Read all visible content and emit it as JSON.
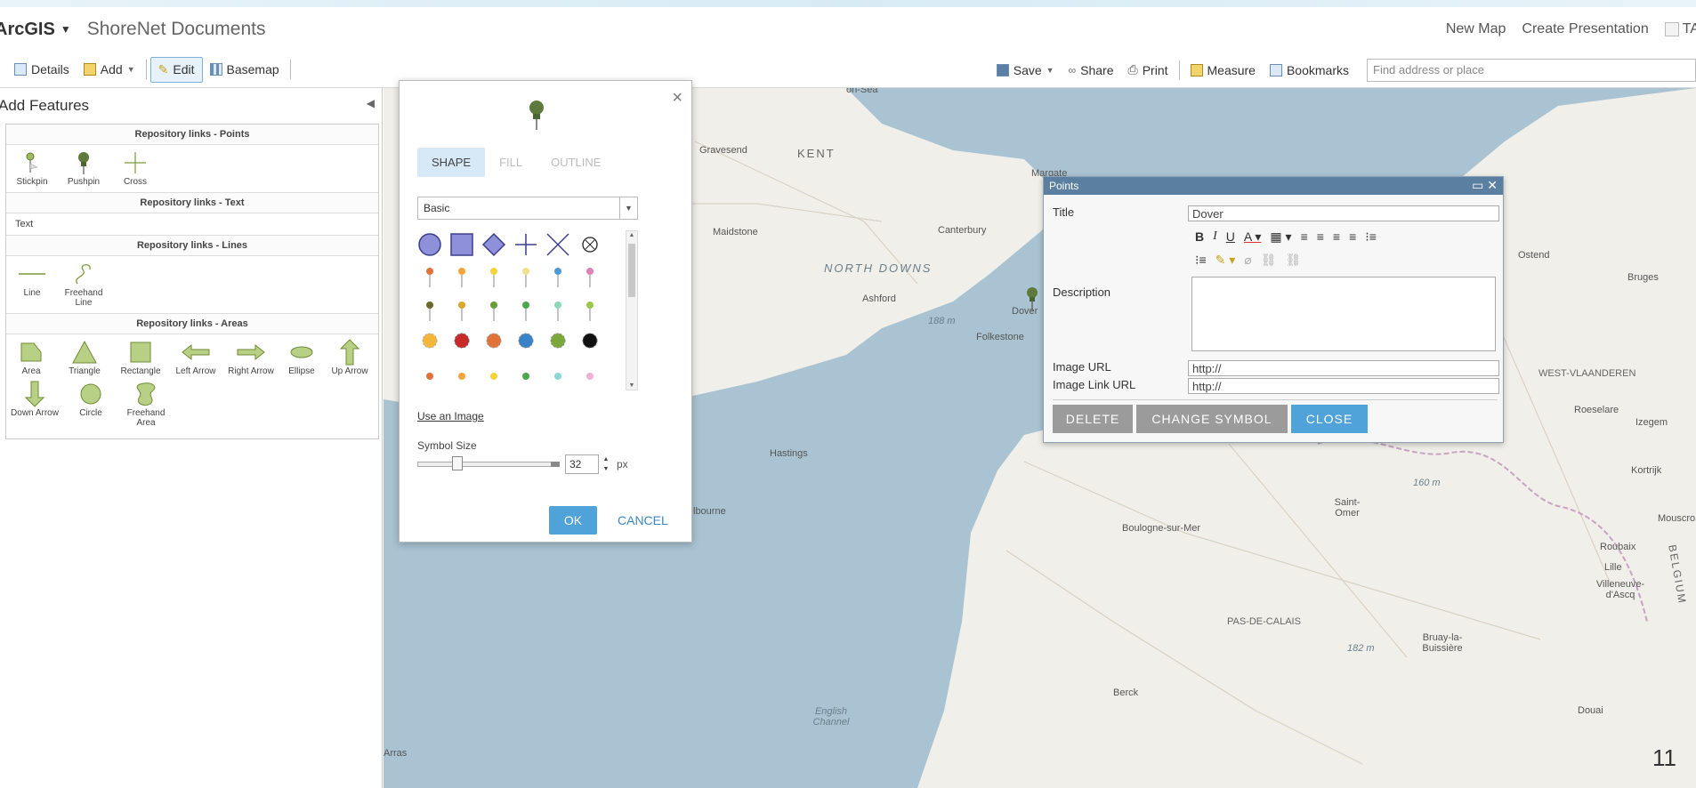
{
  "header": {
    "brand": "ArcGIS",
    "org_title": "ShoreNet Documents",
    "links": [
      "New Map",
      "Create Presentation"
    ],
    "tab_partial": "TA"
  },
  "toolbar": {
    "left": [
      "Details",
      "Add",
      "Edit",
      "Basemap"
    ],
    "right": [
      "Save",
      "Share",
      "Print",
      "Measure",
      "Bookmarks"
    ],
    "search_placeholder": "Find address or place"
  },
  "left_panel": {
    "title": "Add Features",
    "groups": [
      {
        "heading": "Repository links - Points",
        "items": [
          "Stickpin",
          "Pushpin",
          "Cross"
        ]
      },
      {
        "heading": "Repository links - Text",
        "items": [
          "Text"
        ]
      },
      {
        "heading": "Repository links - Lines",
        "items": [
          "Line",
          "Freehand Line"
        ]
      },
      {
        "heading": "Repository links - Areas",
        "items": [
          "Area",
          "Triangle",
          "Rectangle",
          "Left Arrow",
          "Right Arrow",
          "Ellipse",
          "Up Arrow",
          "Down Arrow",
          "Circle",
          "Freehand Area"
        ]
      }
    ]
  },
  "symbol_dialog": {
    "tabs": [
      "SHAPE",
      "FILL",
      "OUTLINE"
    ],
    "active_tab": "SHAPE",
    "category": "Basic",
    "use_image": "Use an Image",
    "size_label": "Symbol Size",
    "size_value": "32",
    "size_unit": "px",
    "ok": "OK",
    "cancel": "CANCEL"
  },
  "popup": {
    "title": "Points",
    "fields": {
      "title_label": "Title",
      "title_value": "Dover",
      "description_label": "Description",
      "image_url_label": "Image URL",
      "image_url_value": "http://",
      "image_link_label": "Image Link URL",
      "image_link_value": "http://"
    },
    "buttons": {
      "delete": "DELETE",
      "change_symbol": "CHANGE SYMBOL",
      "close": "CLOSE"
    }
  },
  "map_labels": {
    "gravesend": "Gravesend",
    "kent": "KENT",
    "margate": "Margate",
    "maidstone": "Maidstone",
    "canterbury": "Canterbury",
    "north_downs": "NORTH DOWNS",
    "ashford": "Ashford",
    "dover": "Dover",
    "folkestone": "Folkestone",
    "hastings": "Hastings",
    "eastbourne": "lbourne",
    "ostend": "Ostend",
    "bruges": "Bruges",
    "west_vlaanderen": "WEST-VLAANDEREN",
    "roeselare": "Roeselare",
    "izegem": "Izegem",
    "kortrijk": "Kortrijk",
    "saint_omer": "Saint-Omer",
    "boulogne": "Boulogne-sur-Mer",
    "roubaix": "Roubaix",
    "lille": "Lille",
    "villeneuve": "Villeneuve-d'Ascq",
    "belgium": "BELGIUM",
    "pas_de_calais": "PAS-DE-CALAIS",
    "bruay": "Bruay-la-Buissière",
    "berck": "Berck",
    "douai": "Douai",
    "arras": "Arras",
    "channel": "English Channel",
    "elev_188": "188 m",
    "elev_160": "160 m",
    "elev_182": "182 m",
    "on_sea": "on-Sea",
    "mousc": "Mouscro"
  },
  "page_number": "11"
}
